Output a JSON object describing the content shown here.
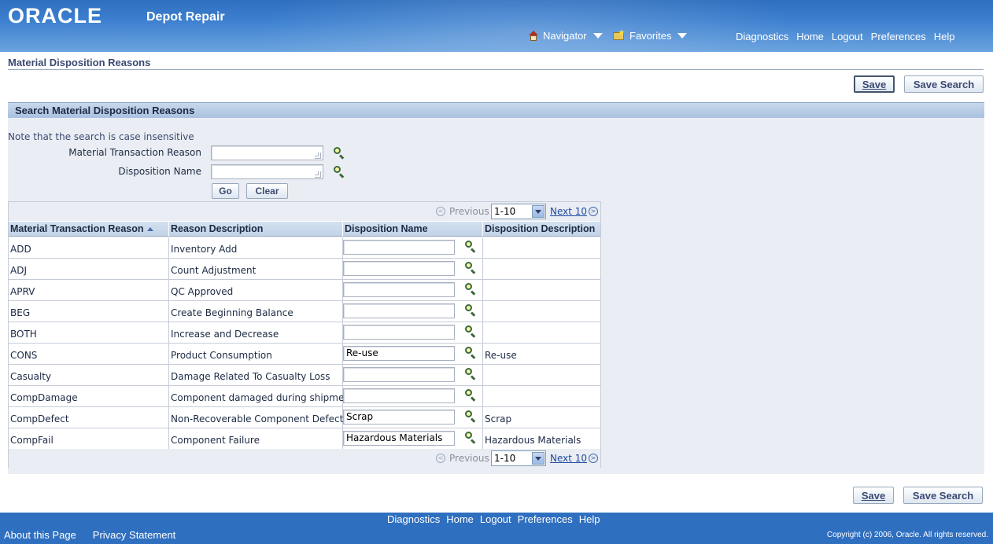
{
  "header": {
    "logo": "ORACLE",
    "app_title": "Depot Repair",
    "navigator": "Navigator",
    "favorites": "Favorites",
    "global_links": [
      "Diagnostics",
      "Home",
      "Logout",
      "Preferences",
      "Help"
    ]
  },
  "page": {
    "title": "Material Disposition Reasons",
    "save_label": "Save",
    "save_search_label": "Save Search"
  },
  "search": {
    "header": "Search Material Disposition Reasons",
    "note": "Note that the search is case insensitive",
    "fields": [
      {
        "label": "Material Transaction Reason",
        "value": ""
      },
      {
        "label": "Disposition Name",
        "value": ""
      }
    ],
    "go_label": "Go",
    "clear_label": "Clear"
  },
  "results": {
    "nav": {
      "previous": "Previous",
      "range": "1-10",
      "next": "Next 10"
    },
    "columns": [
      "Material Transaction Reason",
      "Reason Description",
      "Disposition Name",
      "Disposition Description"
    ],
    "rows": [
      {
        "reason": "ADD",
        "description": "Inventory Add",
        "disposition_name": "",
        "disposition_description": ""
      },
      {
        "reason": "ADJ",
        "description": "Count Adjustment",
        "disposition_name": "",
        "disposition_description": ""
      },
      {
        "reason": "APRV",
        "description": "QC Approved",
        "disposition_name": "",
        "disposition_description": ""
      },
      {
        "reason": "BEG",
        "description": "Create Beginning Balance",
        "disposition_name": "",
        "disposition_description": ""
      },
      {
        "reason": "BOTH",
        "description": "Increase and Decrease",
        "disposition_name": "",
        "disposition_description": ""
      },
      {
        "reason": "CONS",
        "description": "Product Consumption",
        "disposition_name": "Re-use",
        "disposition_description": "Re-use"
      },
      {
        "reason": "Casualty",
        "description": "Damage Related To Casualty Loss",
        "disposition_name": "",
        "disposition_description": ""
      },
      {
        "reason": "CompDamage",
        "description": "Component damaged during shipment",
        "disposition_name": "",
        "disposition_description": ""
      },
      {
        "reason": "CompDefect",
        "description": "Non-Recoverable Component Defect",
        "disposition_name": "Scrap",
        "disposition_description": "Scrap"
      },
      {
        "reason": "CompFail",
        "description": "Component Failure",
        "disposition_name": "Hazardous Materials",
        "disposition_description": "Hazardous Materials"
      }
    ]
  },
  "footer": {
    "links": [
      "Diagnostics",
      "Home",
      "Logout",
      "Preferences",
      "Help"
    ],
    "about": "About this Page",
    "privacy": "Privacy Statement",
    "copyright": "Copyright (c) 2006, Oracle. All rights reserved."
  },
  "colors": {
    "header_blue": "#2f6fbf",
    "panel_bg": "#eaedf3",
    "title_text": "#3c4a72"
  },
  "icons": {
    "navigator": "house-icon",
    "favorites": "favorites-folder-icon",
    "lov": "flashlight-search-icon",
    "sort": "sort-ascending-icon"
  }
}
